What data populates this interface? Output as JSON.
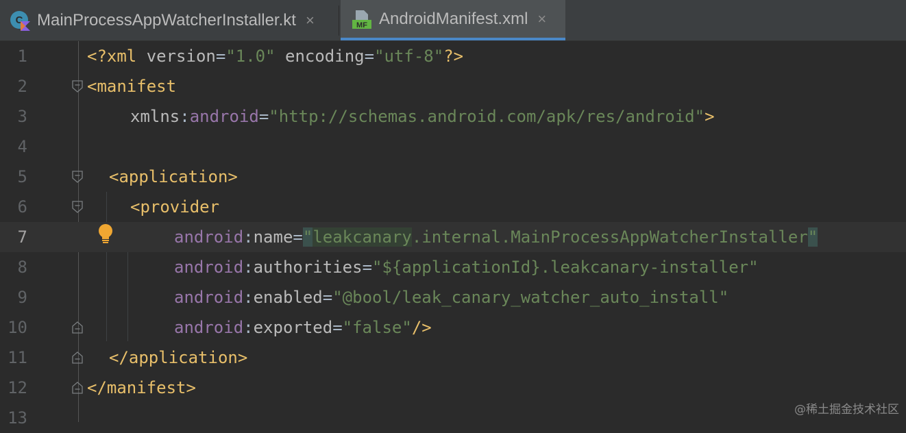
{
  "tabs": [
    {
      "label": "MainProcessAppWatcherInstaller.kt",
      "icon": "kotlin-class-icon",
      "close": "×"
    },
    {
      "label": "AndroidManifest.xml",
      "icon": "manifest-file-icon",
      "icon_text": "MF",
      "close": "×",
      "active": true
    }
  ],
  "editor": {
    "current_line": 7,
    "line_numbers": [
      "1",
      "2",
      "3",
      "4",
      "5",
      "6",
      "7",
      "8",
      "9",
      "10",
      "11",
      "12",
      "13"
    ],
    "code": {
      "l1_open": "<?xml ",
      "l1_attr1": "version",
      "l1_eq1": "=",
      "l1_val1": "\"1.0\"",
      "l1_attr2": " encoding",
      "l1_eq2": "=",
      "l1_val2": "\"utf-8\"",
      "l1_close": "?>",
      "l2": "<manifest",
      "l3_attr": "xmlns",
      "l3_colon": ":",
      "l3_ns": "android",
      "l3_eq": "=",
      "l3_val": "\"http://schemas.android.com/apk/res/android\"",
      "l3_close": ">",
      "l5": "<application>",
      "l6": "<provider",
      "l7_ns": "android",
      "l7_colon": ":",
      "l7_attr": "name",
      "l7_eq": "=",
      "l7_q1": "\"",
      "l7_word": "leakcanary",
      "l7_rest": ".internal.MainProcessAppWatcherInstaller",
      "l7_q2": "\"",
      "l8_ns": "android",
      "l8_colon": ":",
      "l8_attr": "authorities",
      "l8_eq": "=",
      "l8_val": "\"${applicationId}.leakcanary-installer\"",
      "l9_ns": "android",
      "l9_colon": ":",
      "l9_attr": "enabled",
      "l9_eq": "=",
      "l9_val": "\"@bool/leak_canary_watcher_auto_install\"",
      "l10_ns": "android",
      "l10_colon": ":",
      "l10_attr": "exported",
      "l10_eq": "=",
      "l10_val": "\"false\"",
      "l10_close": "/>",
      "l11": "</application>",
      "l12": "</manifest>"
    }
  },
  "watermark": "@稀土掘金技术社区",
  "colors": {
    "background": "#2b2b2b",
    "tag": "#e8bf6a",
    "namespace": "#9876aa",
    "string": "#6a8759",
    "active_tab_underline": "#4a88c7"
  }
}
